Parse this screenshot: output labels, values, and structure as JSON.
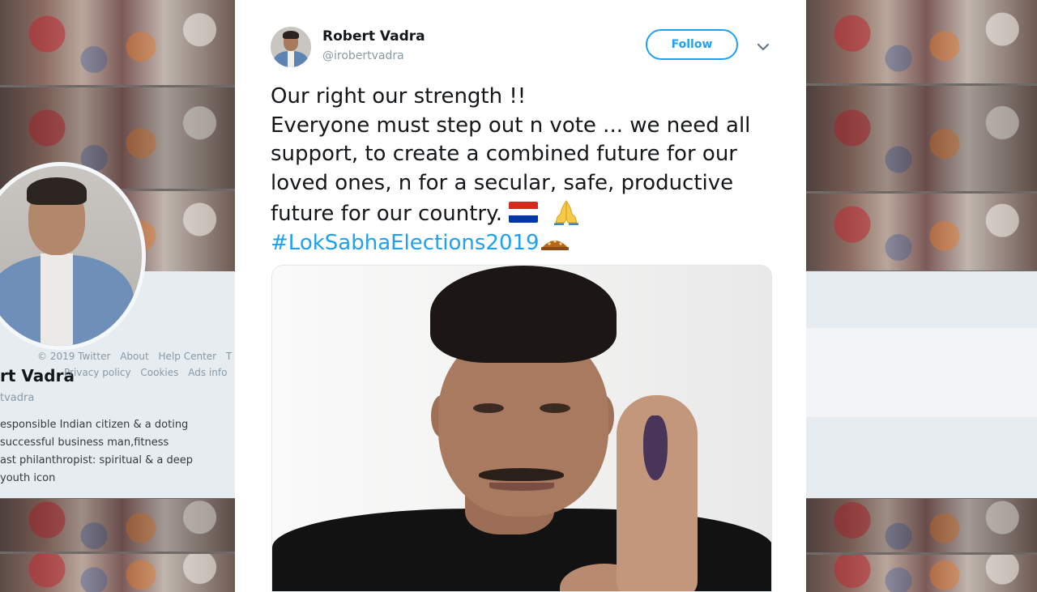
{
  "tweet": {
    "display_name": "Robert Vadra",
    "handle": "@irobertvadra",
    "follow_label": "Follow",
    "text_lines": [
      "Our right our strength !!",
      "Everyone must step out n vote ... we need all",
      "support, to create a combined future for our",
      "loved ones, n for a secular, safe, productive",
      "future for our country."
    ],
    "hashtag": "#LokSabhaElections2019",
    "emoji": [
      "flag-icon",
      "folded-hands-icon",
      "ballot-icon"
    ],
    "link_color": "#1da1f2"
  },
  "profile": {
    "name": "rt Vadra",
    "handle": "tvadra",
    "bio_lines": [
      "esponsible Indian citizen & a doting",
      "successful business man,fitness",
      "ast philanthropist: spiritual & a deep",
      "youth icon"
    ]
  },
  "footer": {
    "links_row1": [
      "© 2019 Twitter",
      "About",
      "Help Center",
      "T"
    ],
    "links_row2": [
      "Privacy policy",
      "Cookies",
      "Ads info"
    ]
  }
}
